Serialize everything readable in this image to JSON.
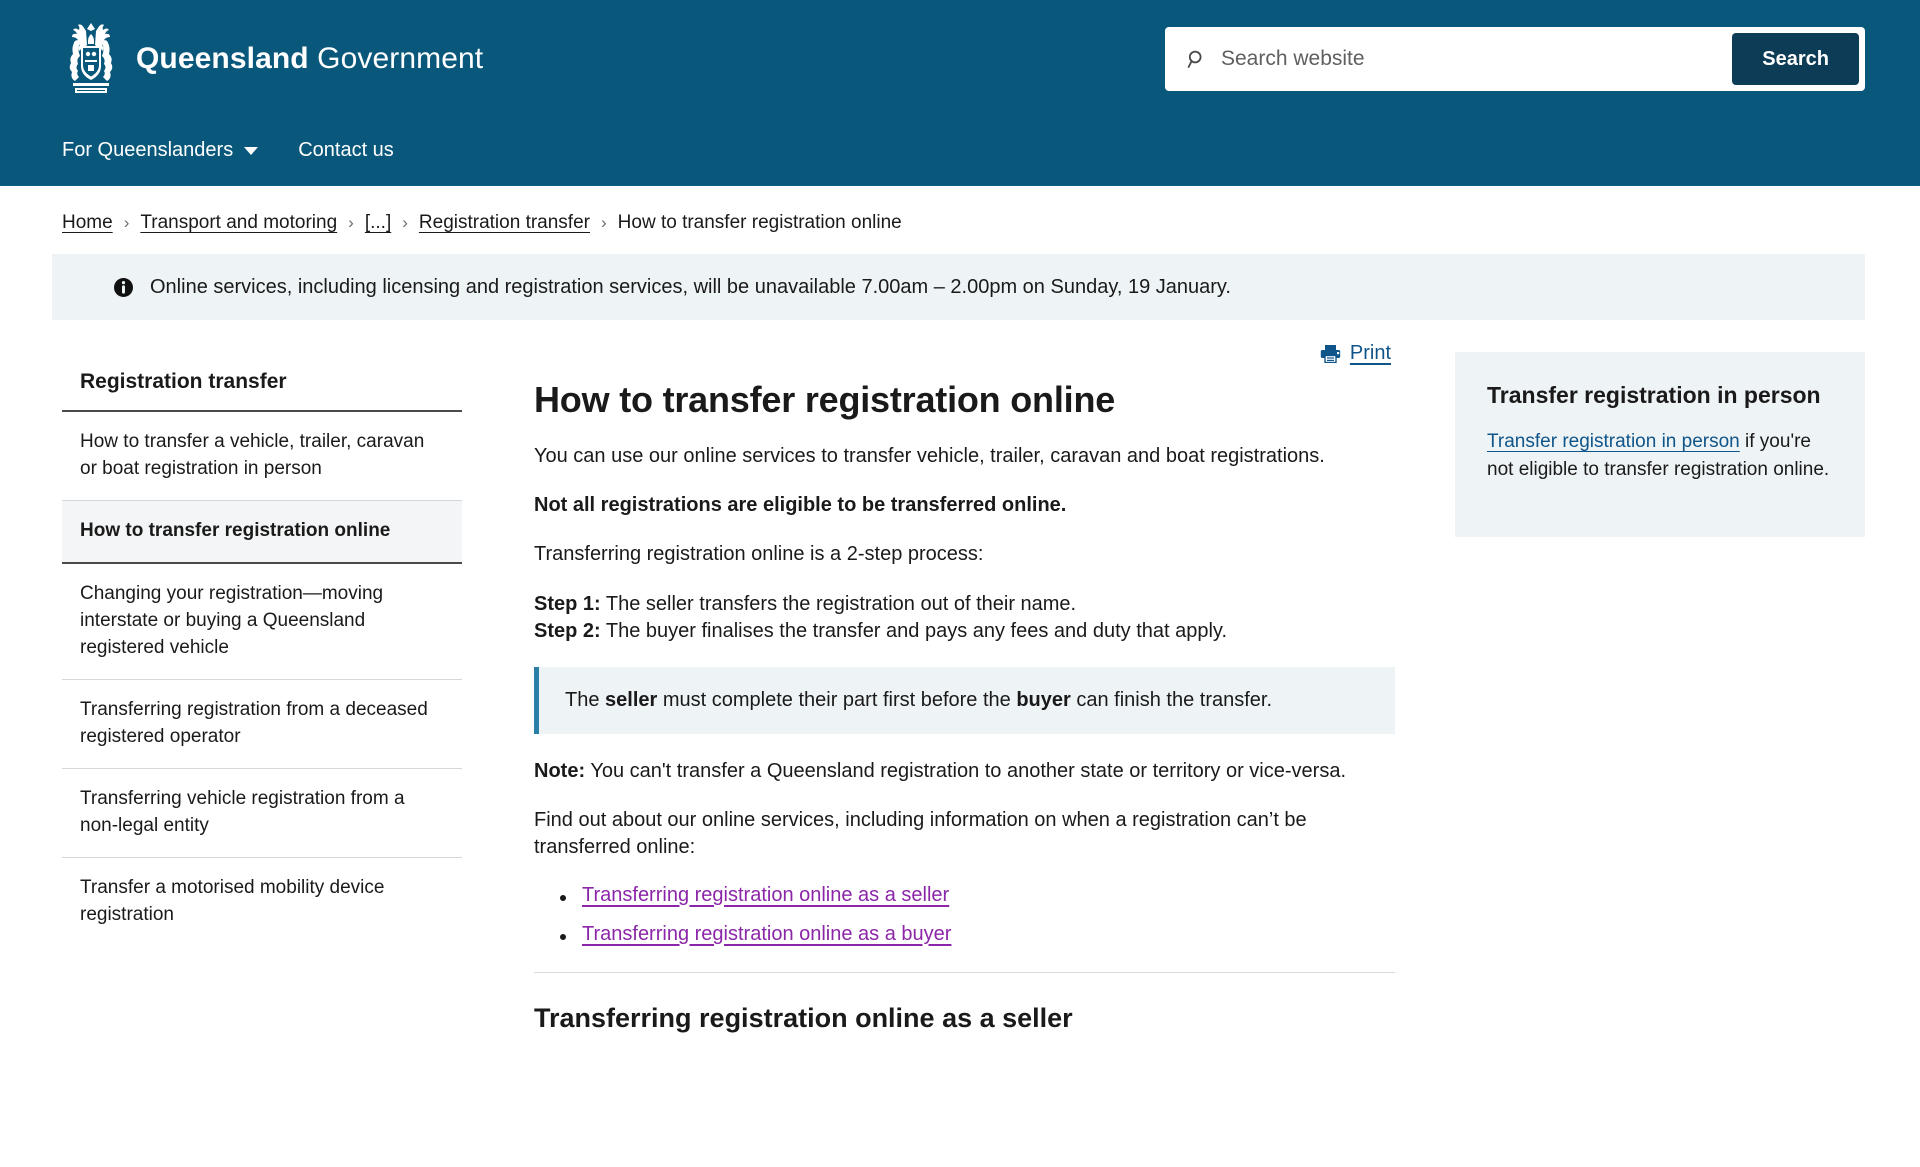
{
  "header": {
    "logo_line1": "Queensland",
    "logo_line2": "Government",
    "crest_icon": "queensland-coat-of-arms",
    "search": {
      "placeholder": "Search website",
      "value": "",
      "button_label": "Search",
      "icon": "search-icon"
    }
  },
  "nav": {
    "items": [
      {
        "label": "For Queenslanders",
        "has_dropdown": true
      },
      {
        "label": "Contact us",
        "has_dropdown": false
      }
    ]
  },
  "breadcrumb": {
    "separator": "›",
    "items": [
      {
        "label": "Home",
        "link": true
      },
      {
        "label": "Transport and motoring",
        "link": true
      },
      {
        "label": "[...]",
        "link": false
      },
      {
        "label": "Registration transfer",
        "link": true
      },
      {
        "label": "How to transfer registration online",
        "link": false
      }
    ]
  },
  "alert": {
    "icon": "info-icon",
    "text": "Online services, including licensing and registration services, will be unavailable 7.00am – 2.00pm on Sunday, 19 January."
  },
  "sidebar": {
    "title": "Registration transfer",
    "items": [
      {
        "label": "How to transfer a vehicle, trailer, caravan or boat registration in person",
        "active": false
      },
      {
        "label": "How to transfer registration online",
        "active": true
      },
      {
        "label": "Changing your registration—moving interstate or buying a Queensland registered vehicle",
        "active": false
      },
      {
        "label": "Transferring registration from a deceased registered operator",
        "active": false
      },
      {
        "label": "Transferring vehicle registration from a non-legal entity",
        "active": false
      },
      {
        "label": "Transfer a motorised mobility device registration",
        "active": false
      }
    ]
  },
  "main": {
    "print": {
      "label": "Print",
      "icon": "printer-icon"
    },
    "title": "How to transfer registration online",
    "intro": "You can use our online services to transfer vehicle, trailer, caravan and boat registrations.",
    "eligibility_note": "Not all registrations are eligible to be transferred online.",
    "process_intro": "Transferring registration online is a 2-step process:",
    "steps": [
      {
        "label": "Step 1:",
        "text": "The seller transfers the registration out of their name."
      },
      {
        "label": "Step 2:",
        "text": "The buyer finalises the transfer and pays any fees and duty that apply."
      }
    ],
    "callout": {
      "prefix": "The ",
      "bold1": "seller",
      "middle": " must complete their part first before the ",
      "bold2": "buyer",
      "suffix": " can finish the transfer."
    },
    "note": {
      "label": "Note:",
      "text": "You can't transfer a Queensland registration to another state or territory or vice-versa."
    },
    "findout": "Find out about our online services, including information on when a registration can’t be transferred online:",
    "links": [
      {
        "label": "Transferring registration online as a seller"
      },
      {
        "label": "Transferring registration online as a buyer"
      }
    ],
    "section_title": "Transferring registration online as a seller"
  },
  "aside": {
    "title": "Transfer registration in person",
    "link_label": "Transfer registration in person",
    "text_after": " if you're not eligible to transfer registration online."
  },
  "colors": {
    "brand_header": "#09577b",
    "search_button": "#0d3c56",
    "alert_bg": "#eef3f6",
    "callout_border": "#2a7fa8",
    "link": "#10558a",
    "visited_link": "#8c26a8",
    "text": "#1a1a1a"
  }
}
